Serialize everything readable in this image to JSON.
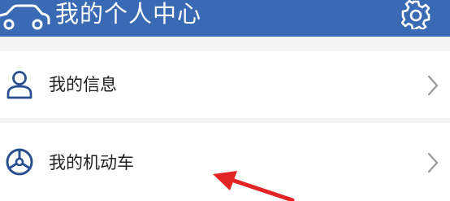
{
  "header": {
    "title": "我的个人中心",
    "background_color": "#3a6ab3",
    "left_icon": "car-icon",
    "right_icon": "gear-icon"
  },
  "menu": {
    "items": [
      {
        "label": "我的信息",
        "icon": "user-icon"
      },
      {
        "label": "我的机动车",
        "icon": "steering-wheel-icon"
      }
    ],
    "chevron_icon": "chevron-right-icon"
  },
  "annotation": {
    "icon": "red-arrow",
    "color": "#e32424"
  }
}
